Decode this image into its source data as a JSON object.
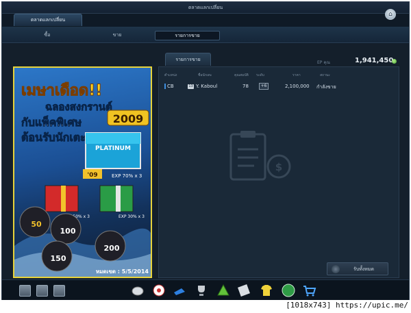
{
  "window": {
    "title": "ตลาดแลกเปลี่ยน"
  },
  "header_tab": {
    "label": "ตลาดแลกเปลี่ยน"
  },
  "subtabs": [
    {
      "label": "ซื้อ"
    },
    {
      "label": "ขาย"
    },
    {
      "label": "รายการขาย"
    }
  ],
  "list": {
    "tab_label": "รายการขาย",
    "ep_label": "EP คุณ",
    "ep_value": "1,941,450",
    "columns": [
      "ตำแหน่ง",
      "ชื่อนักเตะ",
      "คุณสมบัติ",
      "ระดับ",
      "ราคา",
      "สถานะ"
    ],
    "rows": [
      {
        "position": "CB",
        "season": "13",
        "name": "Y. Kaboul",
        "ovr": "78",
        "level": "+6",
        "price": "2,100,000",
        "status": "กำลังขาย"
      }
    ],
    "receive_all_label": "รับทั้งหมด"
  },
  "banner": {
    "line1": "เมษาเดือด!!",
    "line2": "ฉลองสงกรานต์",
    "line3": "กับแพ็คพิเศษ",
    "line4": "ต้อนรับนักเตะ",
    "year": "2009",
    "platinum_label": "PLATINUM",
    "pack_tag_1": "'09",
    "exp_1": "EXP 70% x 3",
    "exp_2": "EXP 50% x 3",
    "exp_3": "EXP 30% x 3",
    "card_values": [
      "50",
      "100",
      "150",
      "200"
    ],
    "expiry": "หมดเขต : 5/5/2014"
  },
  "caption": "[1018x743] https://upic.me/"
}
